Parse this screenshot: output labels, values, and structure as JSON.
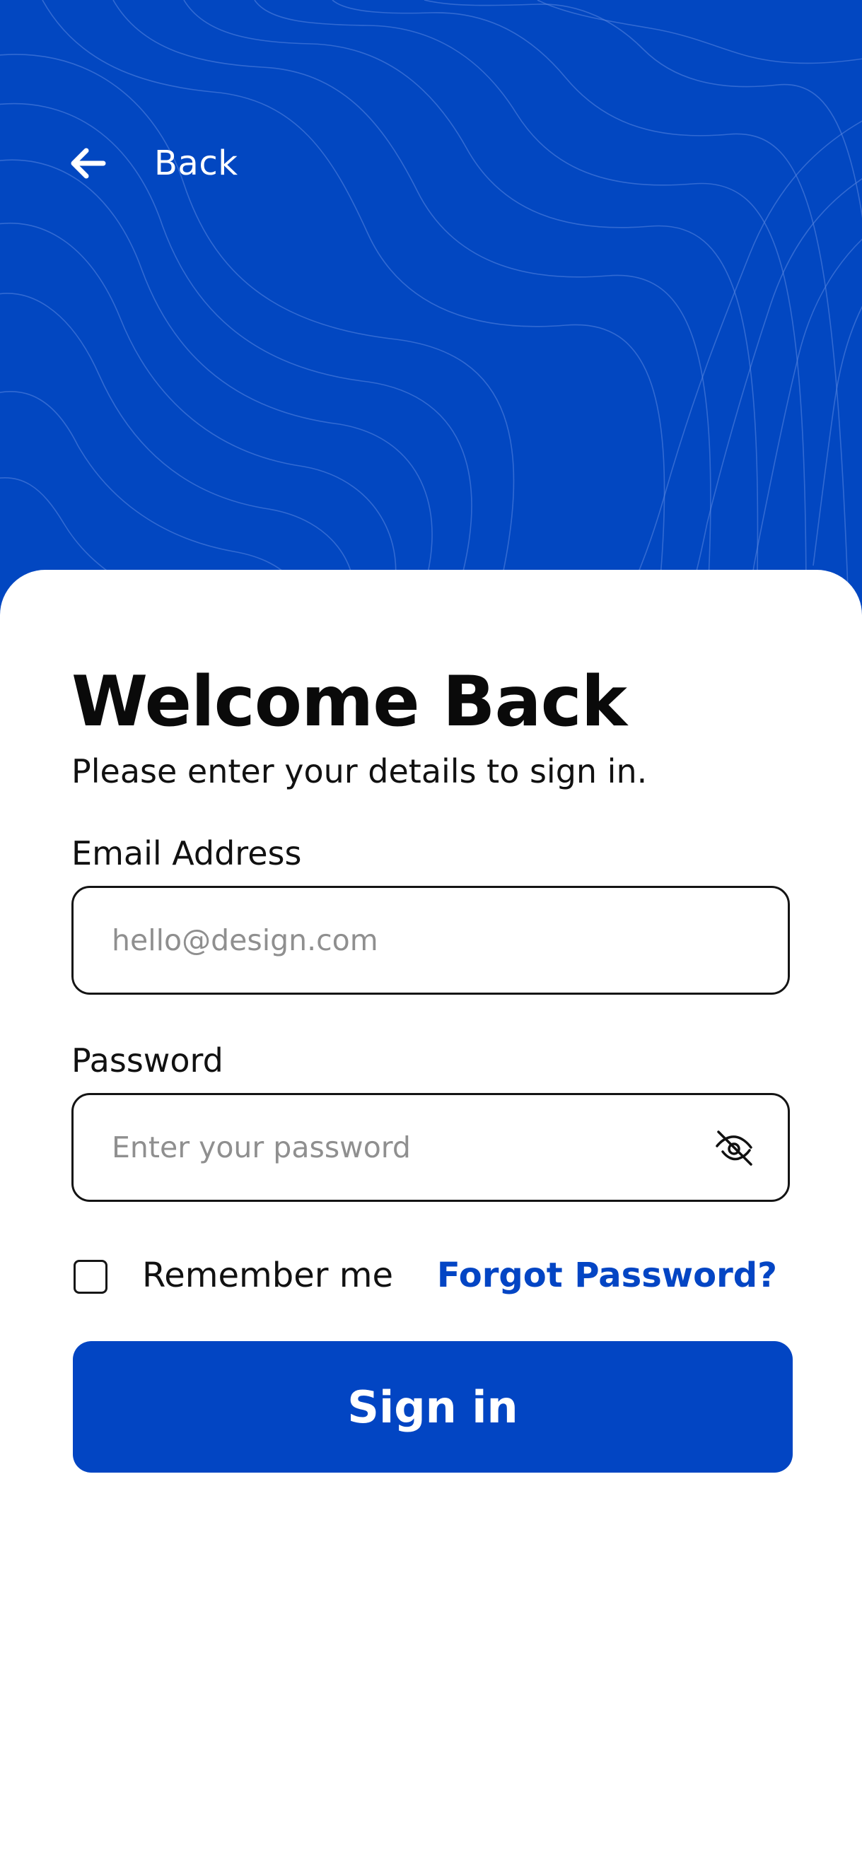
{
  "colors": {
    "primary": "#0245c3",
    "background_blue": "#0247c1",
    "card": "#ffffff",
    "text": "#0b0b0b",
    "placeholder": "#8f8f8f",
    "link": "#0345c4"
  },
  "header": {
    "back_icon": "arrow-left-icon",
    "back_label": "Back"
  },
  "form": {
    "title": "Welcome Back",
    "subtitle": "Please enter your details to sign in.",
    "email": {
      "label": "Email Address",
      "placeholder": "hello@design.com",
      "value": ""
    },
    "password": {
      "label": "Password",
      "placeholder": "Enter your password",
      "value": "",
      "toggle_icon": "eye-off-icon"
    },
    "remember": {
      "label": "Remember me",
      "checked": false
    },
    "forgot_label": "Forgot Password?",
    "submit_label": "Sign in"
  }
}
